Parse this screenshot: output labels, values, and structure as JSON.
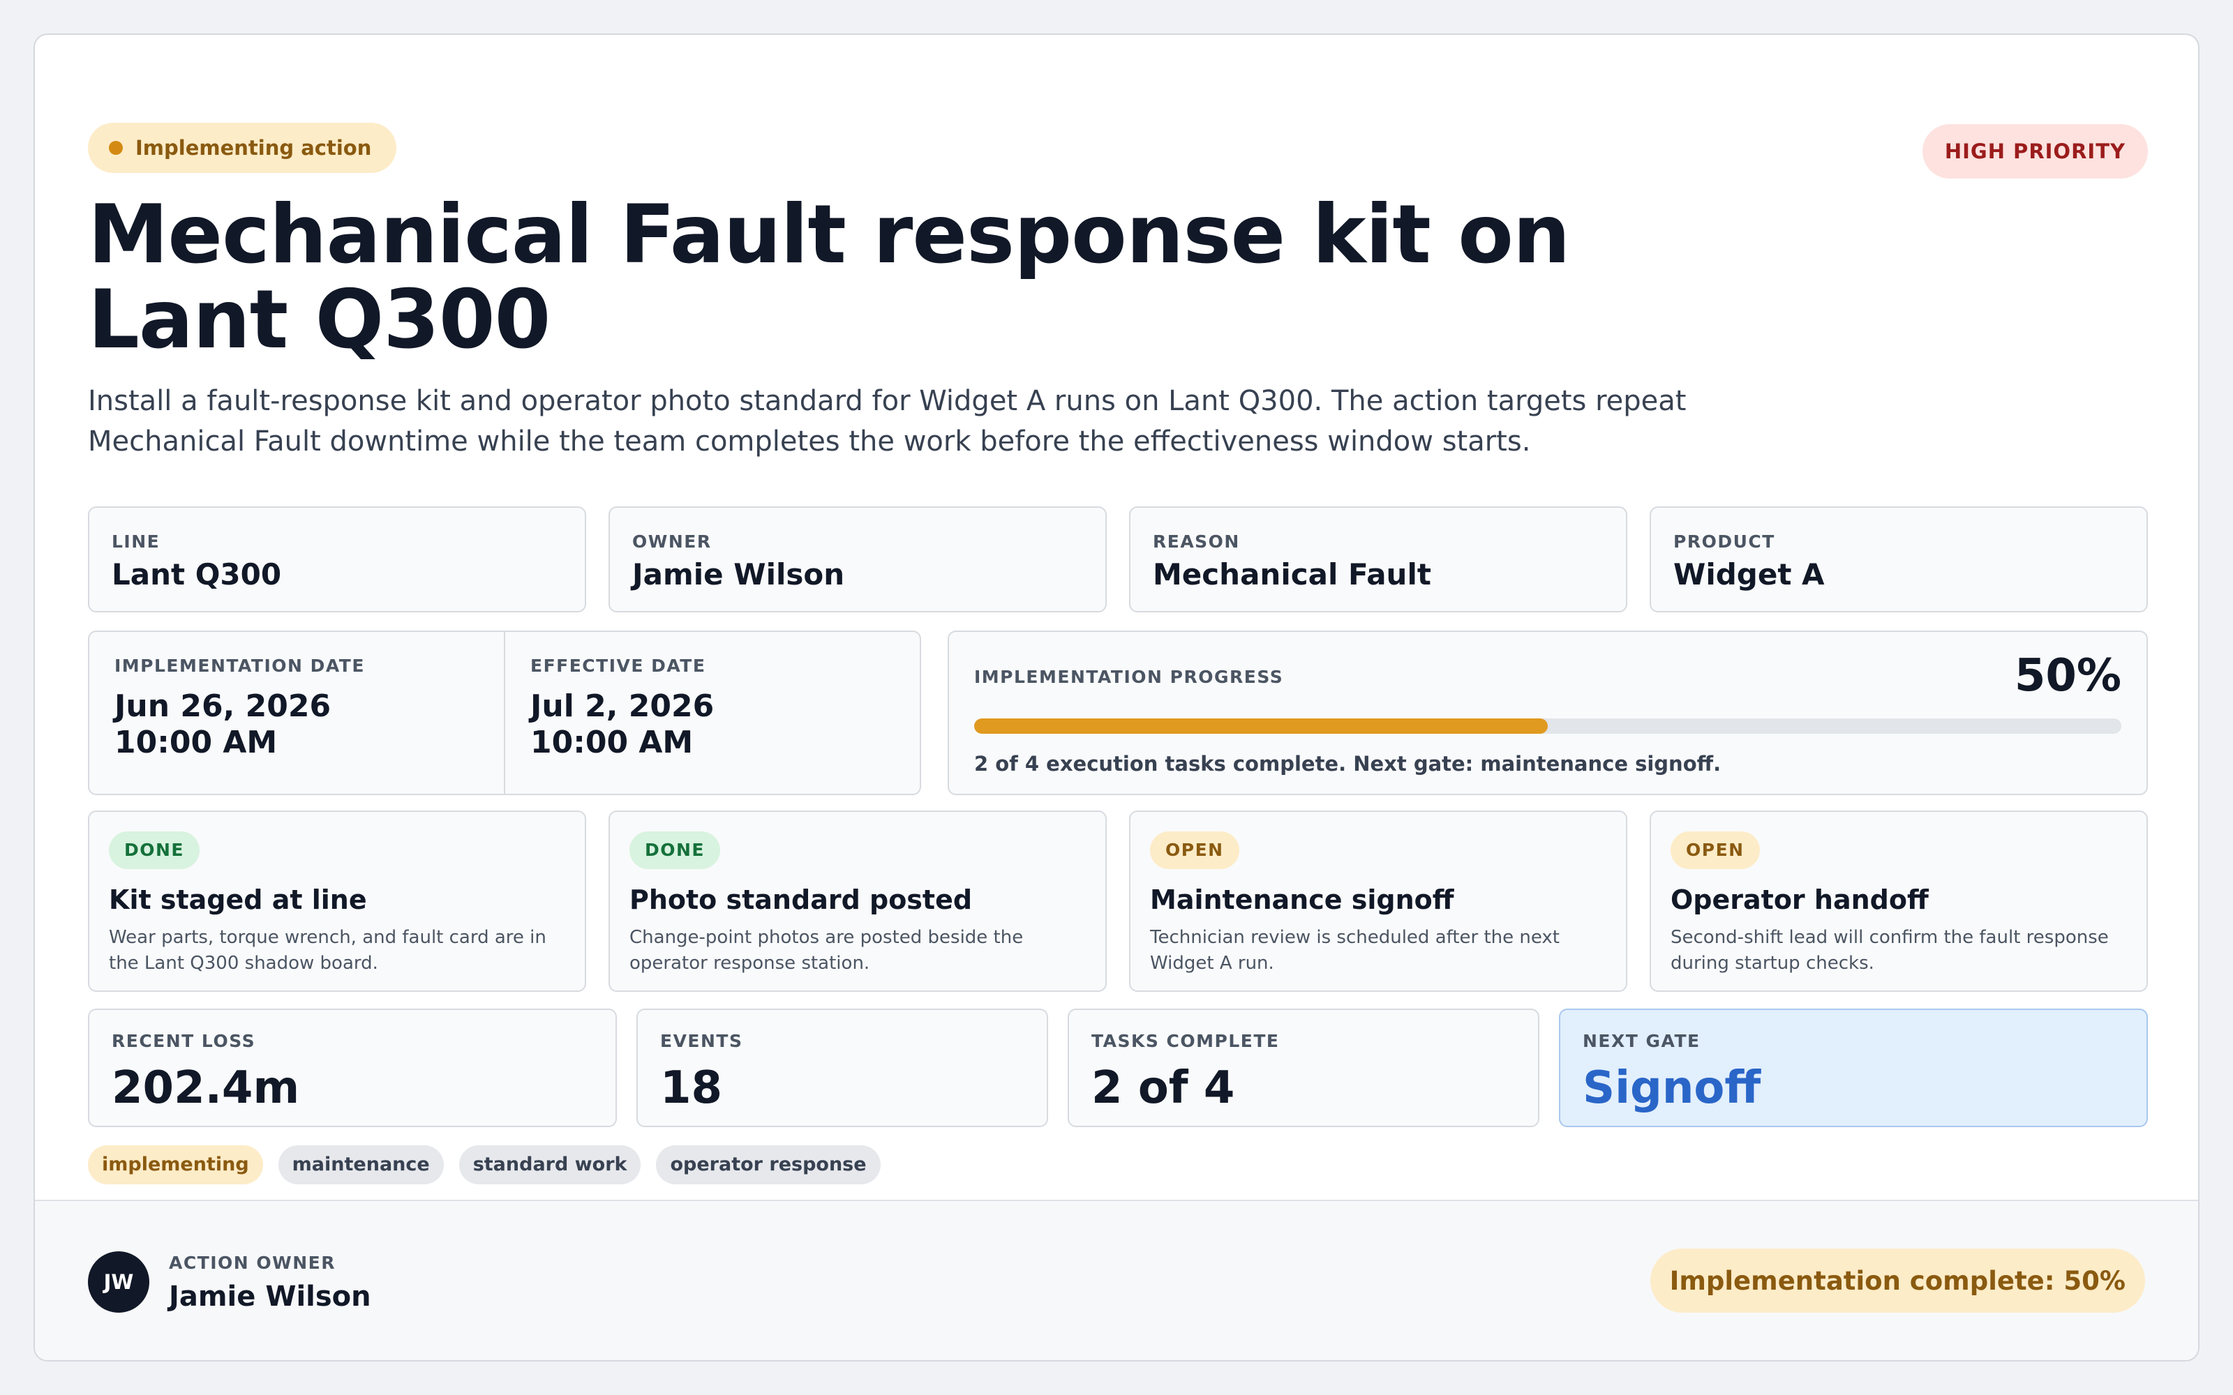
{
  "status_pill": "Implementing action",
  "priority": "HIGH PRIORITY",
  "title": "Mechanical Fault response kit on Lant Q300",
  "description": "Install a fault-response kit and operator photo standard for Widget A runs on Lant Q300. The action targets repeat Mechanical Fault downtime while the team completes the work before the effectiveness window starts.",
  "fields": [
    {
      "label": "LINE",
      "value": "Lant Q300"
    },
    {
      "label": "OWNER",
      "value": "Jamie Wilson"
    },
    {
      "label": "REASON",
      "value": "Mechanical Fault"
    },
    {
      "label": "PRODUCT",
      "value": "Widget A"
    }
  ],
  "dates": {
    "implementation_label": "IMPLEMENTATION DATE",
    "implementation_date": "Jun 26, 2026",
    "implementation_time": "10:00 AM",
    "effective_label": "EFFECTIVE DATE",
    "effective_date": "Jul 2, 2026",
    "effective_time": "10:00 AM"
  },
  "progress": {
    "label": "IMPLEMENTATION PROGRESS",
    "percent_text": "50%",
    "percent": 50,
    "note": "2 of 4 execution tasks complete. Next gate: maintenance signoff."
  },
  "tasks": [
    {
      "status": "DONE",
      "title": "Kit staged at line",
      "text": "Wear parts, torque wrench, and fault card are in the Lant Q300 shadow board."
    },
    {
      "status": "DONE",
      "title": "Photo standard posted",
      "text": "Change-point photos are posted beside the operator response station."
    },
    {
      "status": "OPEN",
      "title": "Maintenance signoff",
      "text": "Technician review is scheduled after the next Widget A run."
    },
    {
      "status": "OPEN",
      "title": "Operator handoff",
      "text": "Second-shift lead will confirm the fault response during startup checks."
    }
  ],
  "metrics": [
    {
      "label": "RECENT LOSS",
      "value": "202.4m"
    },
    {
      "label": "EVENTS",
      "value": "18"
    },
    {
      "label": "TASKS COMPLETE",
      "value": "2 of 4"
    },
    {
      "label": "NEXT GATE",
      "value": "Signoff"
    }
  ],
  "tags": [
    "implementing",
    "maintenance",
    "standard work",
    "operator response"
  ],
  "footer": {
    "avatar_initials": "JW",
    "owner_label": "ACTION OWNER",
    "owner_name": "Jamie Wilson",
    "complete_text": "Implementation complete: 50%"
  },
  "colors": {
    "accent": "#e09a1f",
    "done": "#15703a",
    "open": "#8a5a10",
    "priority": "#9b1c1c",
    "gate": "#2a66c8"
  }
}
